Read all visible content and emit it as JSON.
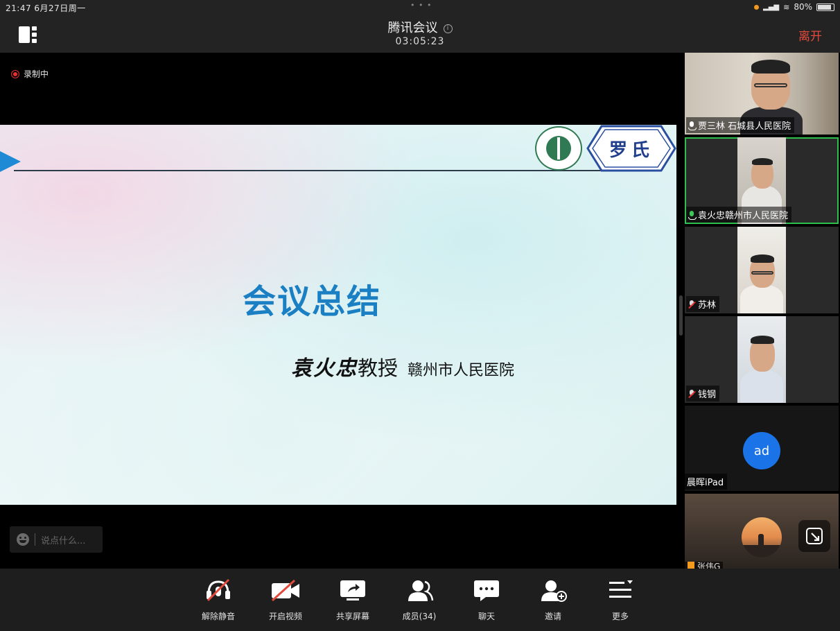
{
  "status_bar": {
    "time": "21:47  6月27日周一",
    "dots": "• • •",
    "battery": "80%"
  },
  "header": {
    "title": "腾讯会议",
    "duration": "03:05:23",
    "leave_label": "离开"
  },
  "stage": {
    "recording_label": "录制中",
    "chat_placeholder": "说点什么..."
  },
  "slide": {
    "brand": "罗氏",
    "title": "会议总结",
    "speaker_name": "袁火忠",
    "speaker_title": "教授",
    "speaker_affiliation": "赣州市人民医院"
  },
  "participants": [
    {
      "name": "贾三林 石城县人民医院",
      "mic": "on"
    },
    {
      "name": "袁火忠赣州市人民医院",
      "mic": "speaking",
      "active": true
    },
    {
      "name": "苏林",
      "mic": "off"
    },
    {
      "name": "钱钢",
      "mic": "off"
    },
    {
      "name": "晨晖iPad",
      "avatar_text": "ad"
    },
    {
      "name": "张伟G"
    }
  ],
  "toolbar": [
    {
      "id": "unmute",
      "label": "解除静音",
      "icon": "mic-muted-icon"
    },
    {
      "id": "video",
      "label": "开启视频",
      "icon": "camera-off-icon"
    },
    {
      "id": "share",
      "label": "共享屏幕",
      "icon": "share-screen-icon"
    },
    {
      "id": "members",
      "label": "成员(34)",
      "icon": "members-icon"
    },
    {
      "id": "chat",
      "label": "聊天",
      "icon": "chat-icon"
    },
    {
      "id": "invite",
      "label": "邀请",
      "icon": "invite-icon"
    },
    {
      "id": "more",
      "label": "更多",
      "icon": "more-icon"
    }
  ],
  "colors": {
    "leave": "#e24a3c",
    "active_border": "#2fbf4c",
    "slide_title": "#1b7fc4",
    "avatar_bg": "#1b73e8",
    "recording": "#e63030"
  }
}
